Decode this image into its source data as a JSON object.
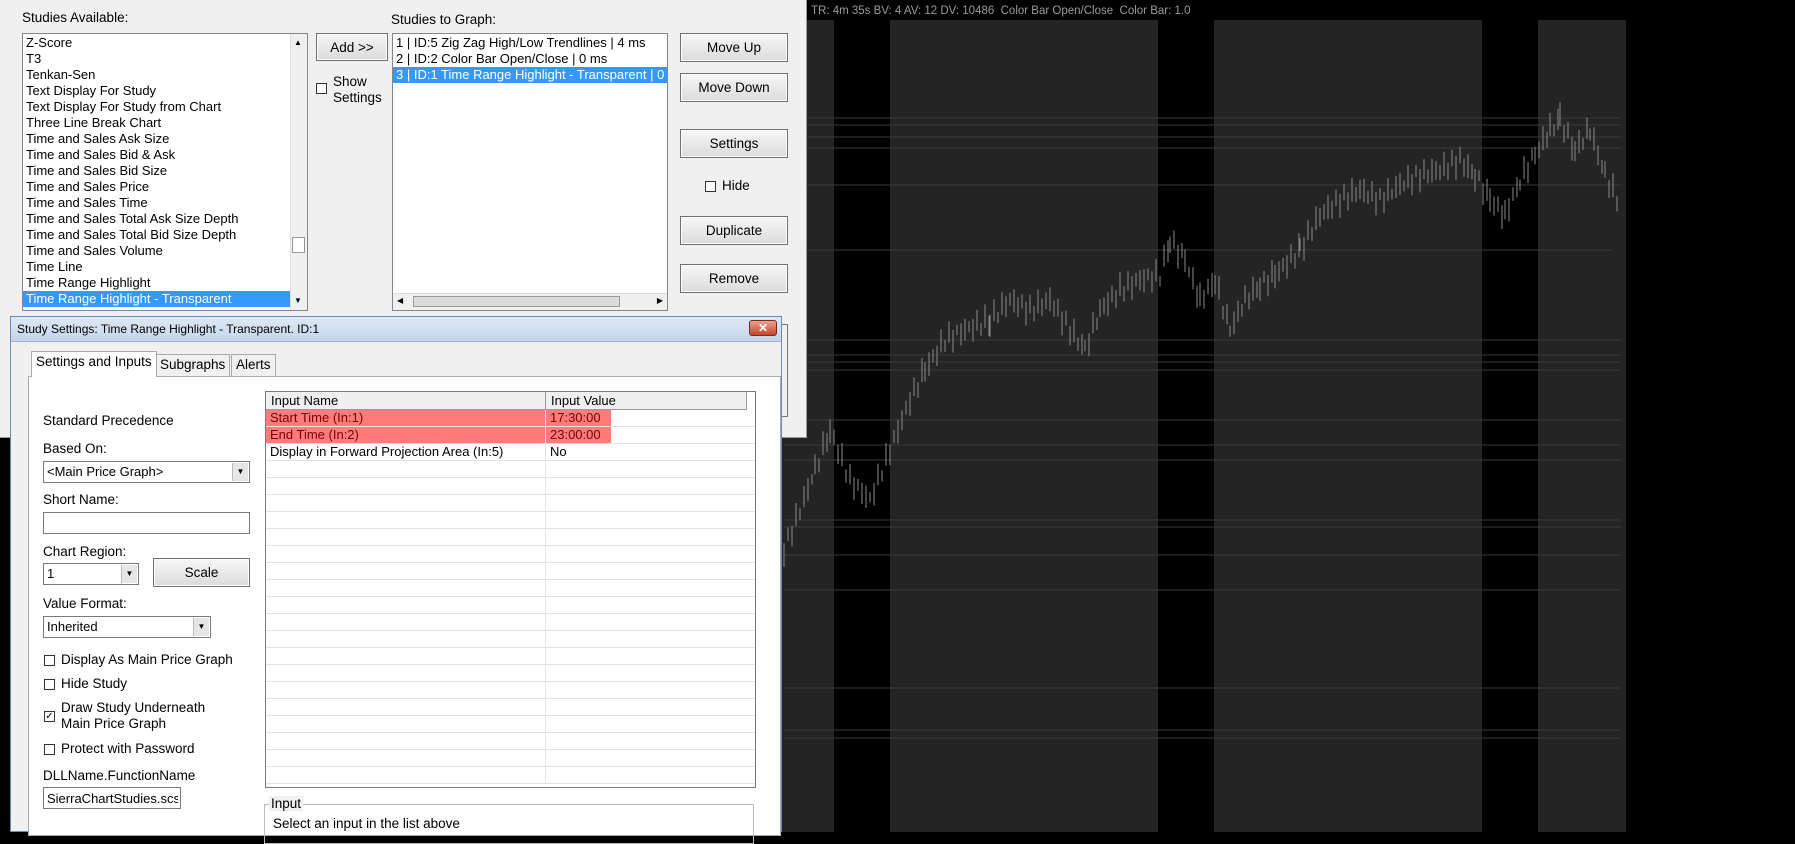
{
  "chart": {
    "status_line": "TR: 4m 35s BV: 4 AV: 12 DV: 10486  Color Bar Open/Close  Color Bar: 1.0"
  },
  "studies_dialog": {
    "available_label": "Studies Available:",
    "available_items": [
      "Z-Score",
      "T3",
      "Tenkan-Sen",
      "Text Display For Study",
      "Text Display For Study from Chart",
      "Three Line Break Chart",
      "Time and Sales Ask Size",
      "Time and Sales Bid & Ask",
      "Time and Sales Bid Size",
      "Time and Sales Price",
      "Time and Sales Time",
      "Time and Sales Total Ask Size Depth",
      "Time and Sales Total Bid Size Depth",
      "Time and Sales Volume",
      "Time Line",
      "Time Range Highlight",
      "Time Range Highlight - Transparent"
    ],
    "available_selected": "Time Range Highlight - Transparent",
    "add_button": "Add >>",
    "show_settings_label": "Show Settings",
    "graph_label": "Studies to Graph:",
    "graph_items": [
      "1 | ID:5  Zig Zag High/Low Trendlines | 4 ms",
      "2 | ID:2  Color Bar Open/Close | 0 ms",
      "3 | ID:1  Time Range Highlight - Transparent | 0"
    ],
    "graph_selected": "3 | ID:1  Time Range Highlight - Transparent | 0",
    "buttons": {
      "move_up": "Move Up",
      "move_down": "Move Down",
      "settings": "Settings",
      "hide": "Hide",
      "duplicate": "Duplicate",
      "remove": "Remove"
    }
  },
  "settings_window": {
    "title": "Study Settings: Time Range Highlight - Transparent. ID:1",
    "close_symbol": "✕",
    "tabs": [
      "Settings and Inputs",
      "Subgraphs",
      "Alerts"
    ],
    "active_tab": "Settings and Inputs",
    "standard_precedence": "Standard Precedence",
    "based_on_label": "Based On:",
    "based_on_value": "<Main Price Graph>",
    "short_name_label": "Short Name:",
    "short_name_value": "",
    "chart_region_label": "Chart Region:",
    "chart_region_value": "1",
    "scale_button": "Scale",
    "value_format_label": "Value Format:",
    "value_format_value": "Inherited",
    "checkboxes": [
      {
        "label": "Display As Main Price Graph",
        "checked": false
      },
      {
        "label": "Hide Study",
        "checked": false
      },
      {
        "label": "Draw Study Underneath Main Price Graph",
        "checked": true
      },
      {
        "label": "Protect with Password",
        "checked": false
      }
    ],
    "dll_label": "DLLName.FunctionName",
    "dll_value": "SierraChartStudies.scs",
    "grid_headers": [
      "Input Name",
      "Input Value"
    ],
    "inputs": [
      {
        "name": "Start Time   (In:1)",
        "value": "17:30:00",
        "highlight": true
      },
      {
        "name": "End Time   (In:2)",
        "value": "23:00:00",
        "highlight": true
      },
      {
        "name": "Display in Forward Projection Area   (In:5)",
        "value": "No",
        "highlight": false
      }
    ],
    "input_group_label": "Input",
    "input_hint": "Select an input in the list above"
  },
  "colors": {
    "chart_background": "#000000",
    "time_highlight_band": "#242424",
    "price_bars": "#8a8a8a",
    "selection": "#3399ff",
    "input_highlight": "#ff7b7b"
  }
}
